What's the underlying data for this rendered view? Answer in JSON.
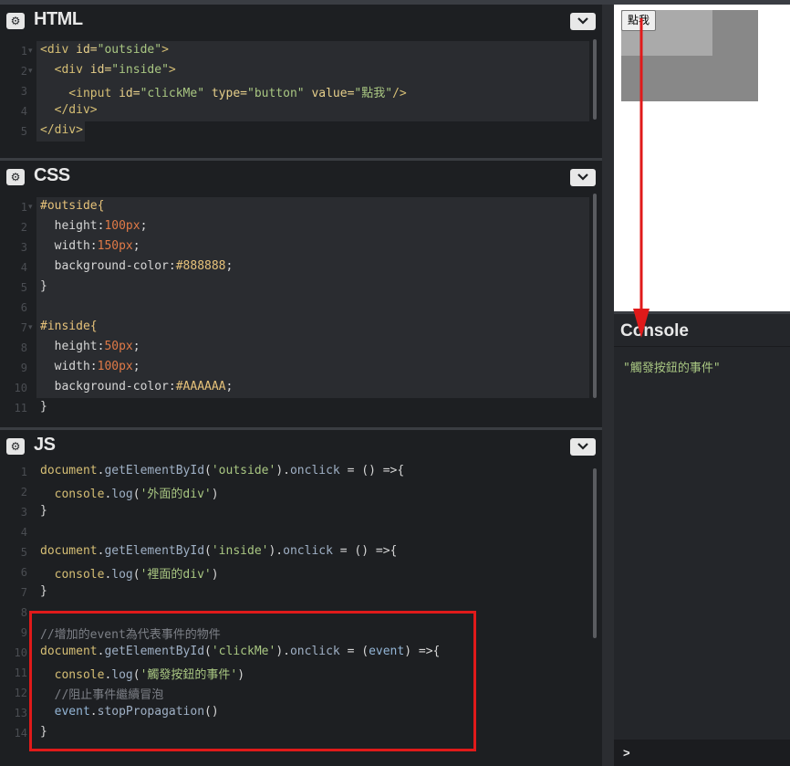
{
  "html_panel": {
    "title": "HTML",
    "line_numbers": [
      "1",
      "2",
      "3",
      "4",
      "5"
    ],
    "lines": [
      [
        {
          "t": "<div ",
          "c": "tag"
        },
        {
          "t": "id=",
          "c": "attr"
        },
        {
          "t": "\"outside\"",
          "c": "str"
        },
        {
          "t": ">",
          "c": "tag"
        }
      ],
      [
        {
          "t": "  <div ",
          "c": "tag"
        },
        {
          "t": "id=",
          "c": "attr"
        },
        {
          "t": "\"inside\"",
          "c": "str"
        },
        {
          "t": ">",
          "c": "tag"
        }
      ],
      [
        {
          "t": "    <input ",
          "c": "tag"
        },
        {
          "t": "id=",
          "c": "attr"
        },
        {
          "t": "\"clickMe\" ",
          "c": "str"
        },
        {
          "t": "type=",
          "c": "attr"
        },
        {
          "t": "\"button\" ",
          "c": "str"
        },
        {
          "t": "value=",
          "c": "attr"
        },
        {
          "t": "\"點我\"",
          "c": "str"
        },
        {
          "t": "/>",
          "c": "tag"
        }
      ],
      [
        {
          "t": "  </div>",
          "c": "tag"
        }
      ],
      [
        {
          "t": "</div>",
          "c": "tag"
        }
      ]
    ]
  },
  "css_panel": {
    "title": "CSS",
    "line_numbers": [
      "1",
      "2",
      "3",
      "4",
      "5",
      "6",
      "7",
      "8",
      "9",
      "10",
      "11"
    ],
    "lines": [
      [
        {
          "t": "#outside{",
          "c": "sel"
        }
      ],
      [
        {
          "t": "  height:",
          "c": "prop"
        },
        {
          "t": "100px",
          "c": "num"
        },
        {
          "t": ";",
          "c": "prop"
        }
      ],
      [
        {
          "t": "  width:",
          "c": "prop"
        },
        {
          "t": "150px",
          "c": "num"
        },
        {
          "t": ";",
          "c": "prop"
        }
      ],
      [
        {
          "t": "  background-color:",
          "c": "prop"
        },
        {
          "t": "#888888",
          "c": "sel"
        },
        {
          "t": ";",
          "c": "prop"
        }
      ],
      [
        {
          "t": "}",
          "c": "prop"
        }
      ],
      [],
      [
        {
          "t": "#inside{",
          "c": "sel"
        }
      ],
      [
        {
          "t": "  height:",
          "c": "prop"
        },
        {
          "t": "50px",
          "c": "num"
        },
        {
          "t": ";",
          "c": "prop"
        }
      ],
      [
        {
          "t": "  width:",
          "c": "prop"
        },
        {
          "t": "100px",
          "c": "num"
        },
        {
          "t": ";",
          "c": "prop"
        }
      ],
      [
        {
          "t": "  background-color:",
          "c": "prop"
        },
        {
          "t": "#AAAAAA",
          "c": "sel"
        },
        {
          "t": ";",
          "c": "prop"
        }
      ],
      [
        {
          "t": "}",
          "c": "prop"
        }
      ]
    ]
  },
  "js_panel": {
    "title": "JS",
    "line_numbers": [
      "1",
      "2",
      "3",
      "4",
      "5",
      "6",
      "7",
      "8",
      "9",
      "10",
      "11",
      "12",
      "13",
      "14"
    ],
    "lines": [
      [
        {
          "t": "document",
          "c": "kw"
        },
        {
          "t": ".",
          "c": "prop"
        },
        {
          "t": "getElementById",
          "c": "fn"
        },
        {
          "t": "(",
          "c": "prop"
        },
        {
          "t": "'outside'",
          "c": "str"
        },
        {
          "t": ").",
          "c": "prop"
        },
        {
          "t": "onclick",
          "c": "fn"
        },
        {
          "t": " = () =>{",
          "c": "prop"
        }
      ],
      [
        {
          "t": "  console",
          "c": "kw"
        },
        {
          "t": ".",
          "c": "prop"
        },
        {
          "t": "log",
          "c": "fn"
        },
        {
          "t": "(",
          "c": "prop"
        },
        {
          "t": "'外面的div'",
          "c": "str"
        },
        {
          "t": ")",
          "c": "prop"
        }
      ],
      [
        {
          "t": "}",
          "c": "prop"
        }
      ],
      [],
      [
        {
          "t": "document",
          "c": "kw"
        },
        {
          "t": ".",
          "c": "prop"
        },
        {
          "t": "getElementById",
          "c": "fn"
        },
        {
          "t": "(",
          "c": "prop"
        },
        {
          "t": "'inside'",
          "c": "str"
        },
        {
          "t": ").",
          "c": "prop"
        },
        {
          "t": "onclick",
          "c": "fn"
        },
        {
          "t": " = () =>{",
          "c": "prop"
        }
      ],
      [
        {
          "t": "  console",
          "c": "kw"
        },
        {
          "t": ".",
          "c": "prop"
        },
        {
          "t": "log",
          "c": "fn"
        },
        {
          "t": "(",
          "c": "prop"
        },
        {
          "t": "'裡面的div'",
          "c": "str"
        },
        {
          "t": ")",
          "c": "prop"
        }
      ],
      [
        {
          "t": "}",
          "c": "prop"
        }
      ],
      [],
      [
        {
          "t": "//增加的event為代表事件的物件",
          "c": "cmt"
        }
      ],
      [
        {
          "t": "document",
          "c": "kw"
        },
        {
          "t": ".",
          "c": "prop"
        },
        {
          "t": "getElementById",
          "c": "fn"
        },
        {
          "t": "(",
          "c": "prop"
        },
        {
          "t": "'clickMe'",
          "c": "str"
        },
        {
          "t": ").",
          "c": "prop"
        },
        {
          "t": "onclick",
          "c": "fn"
        },
        {
          "t": " = (",
          "c": "prop"
        },
        {
          "t": "event",
          "c": "var"
        },
        {
          "t": ") =>{",
          "c": "prop"
        }
      ],
      [
        {
          "t": "  console",
          "c": "kw"
        },
        {
          "t": ".",
          "c": "prop"
        },
        {
          "t": "log",
          "c": "fn"
        },
        {
          "t": "(",
          "c": "prop"
        },
        {
          "t": "'觸發按鈕的事件'",
          "c": "str"
        },
        {
          "t": ")",
          "c": "prop"
        }
      ],
      [
        {
          "t": "  //阻止事件繼續冒泡",
          "c": "cmt"
        }
      ],
      [
        {
          "t": "  event",
          "c": "var"
        },
        {
          "t": ".",
          "c": "prop"
        },
        {
          "t": "stopPropagation",
          "c": "fn"
        },
        {
          "t": "()",
          "c": "prop"
        }
      ],
      [
        {
          "t": "}",
          "c": "prop"
        }
      ]
    ]
  },
  "preview": {
    "button_value": "點我"
  },
  "console": {
    "title": "Console",
    "message": "\"觸發按鈕的事件\"",
    "prompt": ">"
  },
  "icons": {
    "panel_settings": "gear-icon",
    "panel_menu": "chevron-down-icon"
  },
  "colors": {
    "outside_bg": "#888888",
    "inside_bg": "#AAAAAA",
    "annotation": "#e01a1a"
  }
}
